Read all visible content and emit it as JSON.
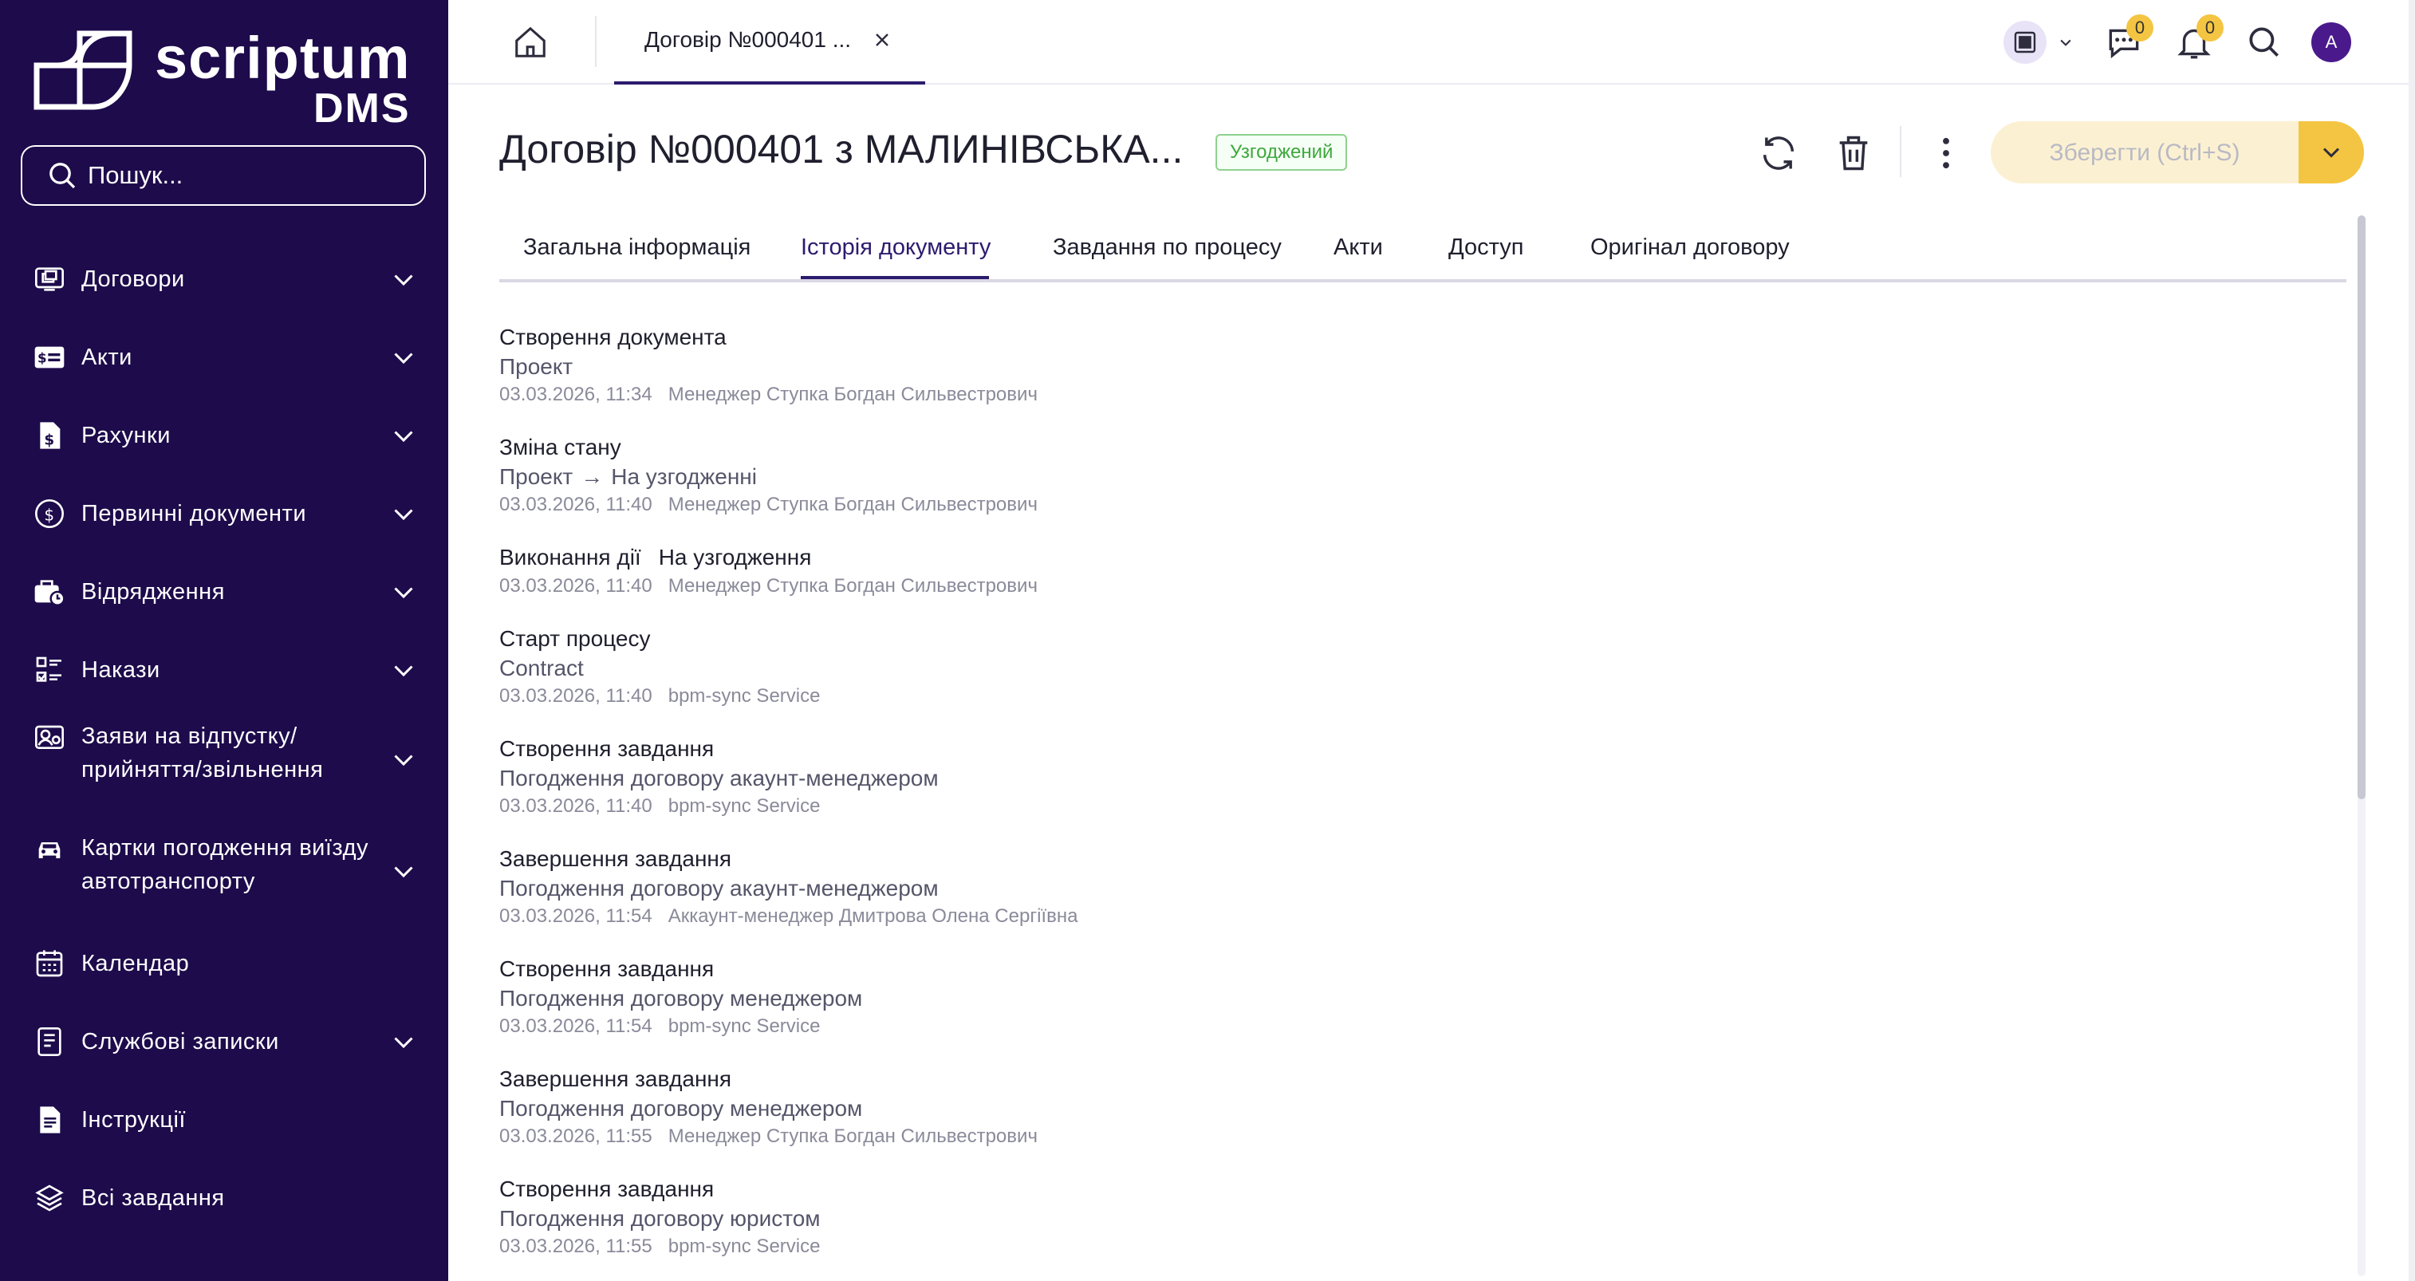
{
  "brand": {
    "name": "scriptum",
    "product": "DMS"
  },
  "search": {
    "placeholder": "Пошук..."
  },
  "sidebar": {
    "items": [
      {
        "label": "Договори",
        "icon": "contracts-icon",
        "expandable": true
      },
      {
        "label": "Акти",
        "icon": "acts-icon",
        "expandable": true
      },
      {
        "label": "Рахунки",
        "icon": "invoice-icon",
        "expandable": true
      },
      {
        "label": "Первинні документи",
        "icon": "dollar-circle-icon",
        "expandable": true
      },
      {
        "label": "Відрядження",
        "icon": "briefcase-clock-icon",
        "expandable": true
      },
      {
        "label": "Накази",
        "icon": "checklist-icon",
        "expandable": true
      },
      {
        "label": "Заяви на відпустку/ прийняття/звільнення",
        "icon": "profile-card-icon",
        "expandable": true
      },
      {
        "label": "Картки погодження виїзду автотранспорту",
        "icon": "car-icon",
        "expandable": true
      },
      {
        "label": "Календар",
        "icon": "calendar-icon",
        "expandable": false
      },
      {
        "label": "Службові записки",
        "icon": "note-icon",
        "expandable": true
      },
      {
        "label": "Інструкції",
        "icon": "instructions-icon",
        "expandable": false
      },
      {
        "label": "Всі завдання",
        "icon": "layers-icon",
        "expandable": false
      }
    ]
  },
  "topbar": {
    "tab_label": "Договір №000401 ...",
    "chat_count": "0",
    "notification_count": "0",
    "avatar_initial": "A"
  },
  "header": {
    "title": "Договір №000401 з МАЛИНІВСЬКА...",
    "status": "Узгоджений",
    "status_color": "#3ea83e",
    "save_label": "Зберегти (Ctrl+S)",
    "accent": "#f4c542",
    "brand_color": "#1d0b4b"
  },
  "tabs": [
    {
      "label": "Загальна інформація",
      "active": false
    },
    {
      "label": "Історія документу",
      "active": true
    },
    {
      "label": "Завдання по процесу",
      "active": false
    },
    {
      "label": "Акти",
      "active": false
    },
    {
      "label": "Доступ",
      "active": false
    },
    {
      "label": "Оригінал договору",
      "active": false
    }
  ],
  "history": [
    {
      "title": "Створення документа",
      "detail": "Проект",
      "date": "03.03.2026, 11:34",
      "user": "Менеджер Ступка Богдан Сильвестрович"
    },
    {
      "title": "Зміна стану",
      "from": "Проект",
      "to": "На узгодженні",
      "date": "03.03.2026, 11:40",
      "user": "Менеджер Ступка Богдан Сильвестрович"
    },
    {
      "title": "Виконання дії",
      "action": "На узгодження",
      "date": "03.03.2026, 11:40",
      "user": "Менеджер Ступка Богдан Сильвестрович"
    },
    {
      "title": "Старт процесу",
      "detail": "Contract",
      "date": "03.03.2026, 11:40",
      "user": "bpm-sync Service"
    },
    {
      "title": "Створення завдання",
      "detail": "Погодження договору акаунт-менеджером",
      "date": "03.03.2026, 11:40",
      "user": "bpm-sync Service"
    },
    {
      "title": "Завершення завдання",
      "detail": "Погодження договору акаунт-менеджером",
      "date": "03.03.2026, 11:54",
      "user": "Аккаунт-менеджер Дмитрова Олена Сергіївна"
    },
    {
      "title": "Створення завдання",
      "detail": "Погодження договору менеджером",
      "date": "03.03.2026, 11:54",
      "user": "bpm-sync Service"
    },
    {
      "title": "Завершення завдання",
      "detail": "Погодження договору менеджером",
      "date": "03.03.2026, 11:55",
      "user": "Менеджер Ступка Богдан Сильвестрович"
    },
    {
      "title": "Створення завдання",
      "detail": "Погодження договору юристом",
      "date": "03.03.2026, 11:55",
      "user": "bpm-sync Service"
    }
  ]
}
